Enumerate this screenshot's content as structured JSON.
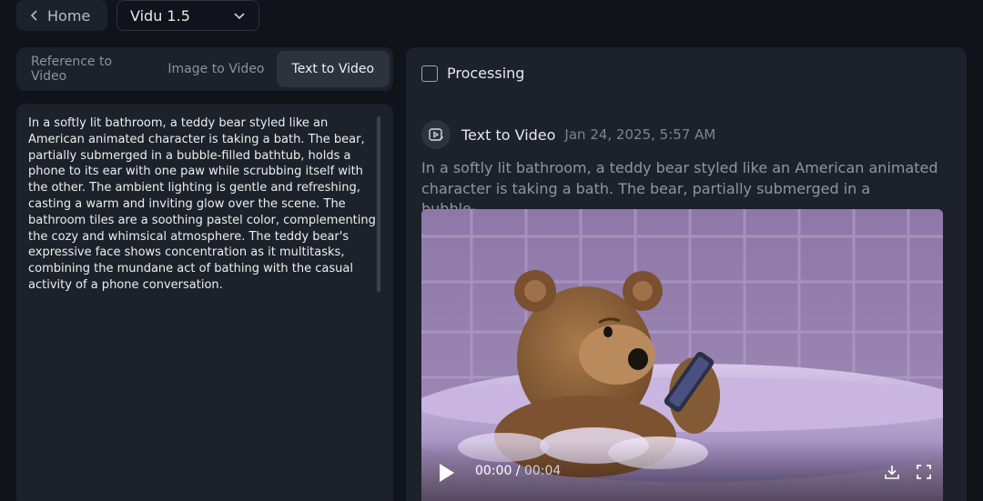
{
  "header": {
    "home_label": "Home",
    "model_value": "Vidu 1.5"
  },
  "tabs": [
    {
      "label": "Reference to Video",
      "active": false
    },
    {
      "label": "Image to Video",
      "active": false
    },
    {
      "label": "Text to Video",
      "active": true
    }
  ],
  "prompt": {
    "text": "In a softly lit bathroom, a teddy bear styled like an American animated character is taking a bath. The bear, partially submerged in a bubble-filled bathtub, holds a phone to its ear with one paw while scrubbing itself with the other. The ambient lighting is gentle and refreshing, casting a warm and inviting glow over the scene. The bathroom tiles are a soothing pastel color, complementing the cozy and whimsical atmosphere. The teddy bear's expressive face shows concentration as it multitasks, combining the mundane act of bathing with the casual activity of a phone conversation."
  },
  "result": {
    "status_label": "Processing",
    "type_label": "Text to Video",
    "timestamp": "Jan 24, 2025, 5:57 AM",
    "description_line1": "In a softly lit bathroom, a teddy bear styled like an American animated",
    "description_line2": "character is taking a bath. The bear, partially submerged in a bubble-...",
    "video": {
      "current_time": "00:00",
      "separator": " / ",
      "duration": "00:04"
    }
  },
  "icons": {
    "back": "chevron-left-icon",
    "dropdown": "chevron-down-icon",
    "text_to_video": "video-edit-icon",
    "play": "play-icon",
    "download": "download-icon",
    "fullscreen": "fullscreen-icon"
  }
}
